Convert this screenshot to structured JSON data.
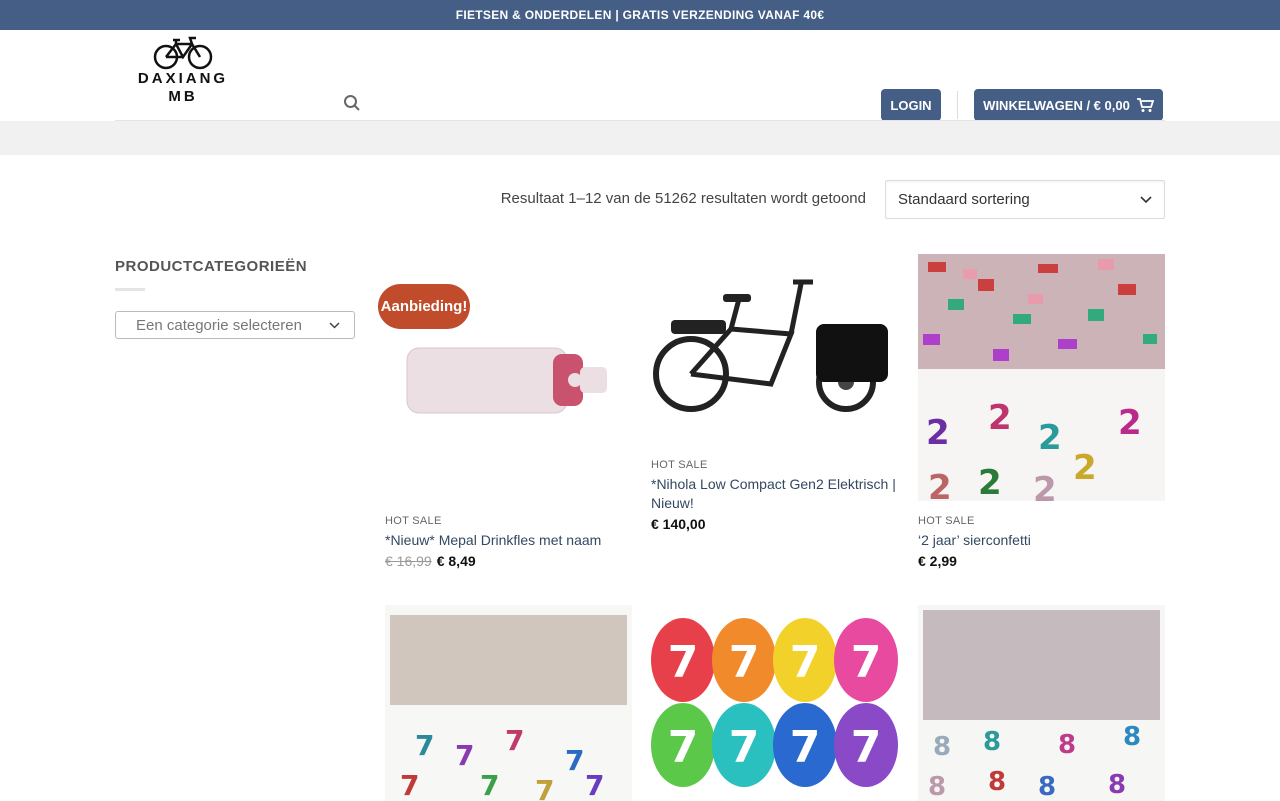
{
  "topbar": {
    "text": "FIETSEN & ONDERDELEN | GRATIS VERZENDING VANAF 40€"
  },
  "logo": {
    "line1": "DAXIANG",
    "line2": "MB"
  },
  "header": {
    "login_label": "LOGIN",
    "cart_label": "WINKELWAGEN / € 0,00"
  },
  "results": {
    "text": "Resultaat 1–12 van de 51262 resultaten wordt getoond",
    "sort_selected": "Standaard sortering"
  },
  "sidebar": {
    "heading": "PRODUCTCATEGORIEËN",
    "select_placeholder": "Een categorie selecteren"
  },
  "products": [
    {
      "badge": "Aanbieding!",
      "label": "HOT SALE",
      "title": "*Nieuw* Mepal Drinkfles met naam",
      "old_price": "€ 16,99",
      "price": "€ 8,49"
    },
    {
      "label": "HOT SALE",
      "title": "*Nihola Low Compact Gen2 Elektrisch | Nieuw!",
      "price": "€ 140,00"
    },
    {
      "label": "HOT SALE",
      "title": "‘2 jaar’ sierconfetti",
      "price": "€ 2,99"
    }
  ],
  "colors": {
    "accent": "#445e85",
    "sale": "#c04c2c"
  }
}
